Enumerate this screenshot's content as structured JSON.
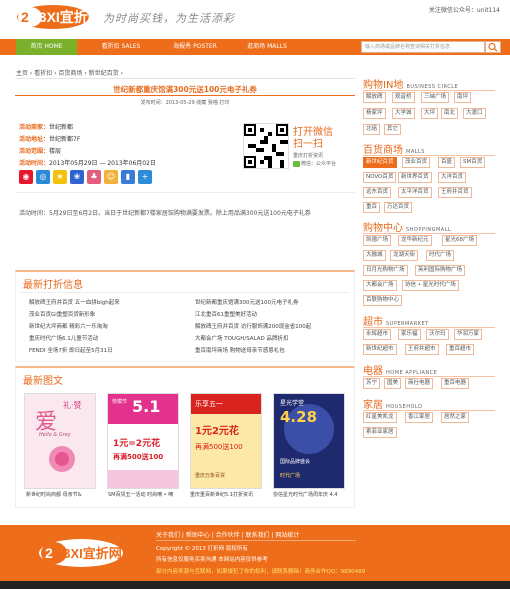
{
  "header": {
    "logo_text": "23XI宜折网",
    "logo_sub": "CN",
    "slogan": "为时尚买钱，为生活添彩",
    "follow": "关注微信公众号：unit114"
  },
  "nav": {
    "items": [
      {
        "label": "首页 HOME"
      },
      {
        "label": "看折扣 SALES"
      },
      {
        "label": "海报秀 POSTER"
      },
      {
        "label": "逛商场 MALLS"
      }
    ],
    "search_placeholder": "输入商场或品牌名称查询相关打折信息"
  },
  "breadcrumb": "主页 › 看折扣 › 百货商场 › 新世纪百货 ›",
  "article": {
    "title": "世纪新都重庆馆满300元送100元电子礼券",
    "meta": "发布时间：2013-05-29    收藏    我喵    打印",
    "fields": [
      {
        "key": "活动商家：",
        "val": "世纪新都"
      },
      {
        "key": "活动地址：",
        "val": "世纪新都7F"
      },
      {
        "key": "活动范围：",
        "val": "楼层"
      },
      {
        "key": "活动时间：",
        "val": "2013年05月29日  —  2013年06月02日"
      }
    ],
    "share_icons": [
      "sina-icon",
      "tencent-icon",
      "qzone-icon",
      "baidu-icon",
      "renren-icon",
      "douban-icon",
      "pengyou-icon",
      "plus-icon"
    ],
    "qr_title": "打开微信\n扫一扫",
    "qr_sub": "重庆打折资讯",
    "qr_sub2": "微信：公众平台",
    "body": "活动时间：5月29日至6月2日。当日于世纪新都7楼家居馆购物满要发票。除上用品满300元送100元电子礼券"
  },
  "latest_news": {
    "title": "最新打折信息",
    "left": [
      "解放碑王府井百货 五一血拼bigh起来",
      "茂业百货Gi重塑百货新形象",
      "新世纪大坪商都 精彩六一乐淘淘",
      "重庆时代广场6.1儿童节活动",
      "FENDI 全场7折 即日起至5月31日"
    ],
    "right": [
      "世纪新都重庆馆满300元送100元电子礼券",
      "江北重百61重塑美好活动",
      "解放碑王府井百货 访行服饰满200现金省100起",
      "大都会广场 TOUGH/SALAD 品牌折扣",
      "重百南坪商场 购物送母亲节感恩礼包"
    ]
  },
  "latest_images": {
    "title": "最新图文",
    "items": [
      {
        "poster_big": "爱",
        "poster_small": "礼·赞",
        "poster_en": "Hello & Grey",
        "cap": "新世纪时尚商都 母亲节&"
      },
      {
        "poster_big": "5.1",
        "poster_small": "劳模节",
        "poster_mid": "1元=2元花",
        "poster_low": "再满500送100",
        "cap": "SM百货五一活动 时尚嘀 • 嘀"
      },
      {
        "poster_big": "1元2元花",
        "poster_small": "乐享五一",
        "poster_mid": "再满500送100",
        "poster_low": "重庆万象百货",
        "cap": "重庆重百新世纪5.1打折资讯"
      },
      {
        "poster_big": "4.28",
        "poster_small": "星光学堂",
        "poster_mid": "国际品牌盛会",
        "poster_low": "时代广场",
        "cap": "协信星光时代广场周年庆 4.4"
      }
    ]
  },
  "sidebar": {
    "sections": [
      {
        "title": "购物IN地",
        "en": "BUSINESS CIRCLE",
        "tags": [
          "解放碑",
          "观音桥",
          "三峡广场",
          "南坪",
          "杨家坪",
          "大学城",
          "大坪",
          "南北",
          "大渡口",
          "北碚",
          "其它"
        ],
        "hi": []
      },
      {
        "title": "百货商场",
        "en": "MALLS",
        "tags": [
          "新世纪百货",
          "茂业百货",
          "百盛",
          "SM百货",
          "NOVO百货",
          "新世界百货",
          "大洋百货",
          "远东百货",
          "太平洋百货",
          "王府井百货",
          "重百",
          "万达百货"
        ],
        "hi": [
          0
        ]
      },
      {
        "title": "购物中心",
        "en": "SHOPPINGMALL",
        "tags": [
          "凯德广场",
          "龙华新纪元",
          "星光68广场",
          "大融城",
          "龙湖天街",
          "时代广场",
          "日月光购物广场",
          "英利国际购物广场",
          "大都会广场",
          "协信 • 星光时代广场",
          "百联购物中心"
        ],
        "hi": []
      },
      {
        "title": "超市",
        "en": "SUPERMARKET",
        "tags": [
          "永辉超市",
          "家乐福",
          "沃尔玛",
          "华润万家",
          "新世纪超市",
          "王府井超市",
          "重百超市"
        ],
        "hi": []
      },
      {
        "title": "电器",
        "en": "HOME APPLIANCE",
        "tags": [
          "苏宁",
          "国美",
          "商社电器",
          "重百电器"
        ],
        "hi": []
      },
      {
        "title": "家居",
        "en": "HOUSEHOLD",
        "tags": [
          "红星美凯龙",
          "香江家居",
          "居然之家",
          "索菲亚家居"
        ],
        "hi": []
      }
    ]
  },
  "footer": {
    "logo_text": "23XI宜折网",
    "links": "关于我们  |  帮助中心  |  合作伙伴  |  联系我们  |  网站统计",
    "copyright": "Copyright © 2013 打折网 版权所有",
    "line2": "所有信息仅服务买卖沟通 本网站内容仅供参考",
    "line3": "部分内容来源与互联网，如果侵犯了你的权利，请联系删除！商务合作QQ：9890489"
  },
  "colors": {
    "brand": "#ee6d1a",
    "active_nav": "#79b12b"
  }
}
